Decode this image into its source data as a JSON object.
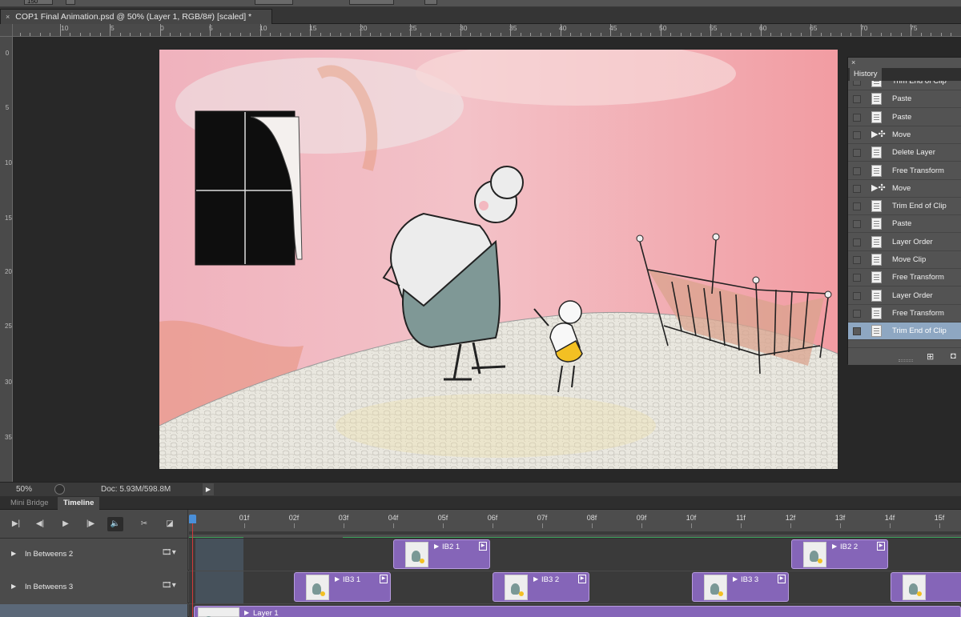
{
  "options_bar": {
    "size_value": "150"
  },
  "document": {
    "title": "COP1 Final Animation.psd @ 50% (Layer 1, RGB/8#) [scaled] *",
    "close_glyph": "×"
  },
  "rulers": {
    "top_labels": [
      "10",
      "5",
      "0",
      "5",
      "10",
      "15",
      "20",
      "25",
      "30",
      "35",
      "40",
      "45",
      "50",
      "55",
      "60",
      "65",
      "70",
      "75"
    ],
    "left_labels": [
      "0",
      "5",
      "10",
      "15",
      "20",
      "25",
      "30",
      "35"
    ]
  },
  "status": {
    "zoom": "50%",
    "doc": "Doc: 5.93M/598.8M"
  },
  "panels": {
    "tabs": [
      {
        "label": "Mini Bridge"
      },
      {
        "label": "Timeline"
      }
    ]
  },
  "timeline": {
    "controls": [
      {
        "icon": "go-to-first-frame-icon",
        "glyph": "▶|"
      },
      {
        "icon": "previous-frame-icon",
        "glyph": "◀|"
      },
      {
        "icon": "play-icon",
        "glyph": "▶"
      },
      {
        "icon": "next-frame-icon",
        "glyph": "|▶"
      },
      {
        "icon": "audio-icon",
        "glyph": "🔈"
      },
      {
        "icon": "split-at-playhead-icon",
        "glyph": "✂"
      },
      {
        "icon": "transition-icon",
        "glyph": "◪"
      }
    ],
    "frames": [
      "01f",
      "02f",
      "03f",
      "04f",
      "05f",
      "06f",
      "07f",
      "08f",
      "09f",
      "10f",
      "11f",
      "12f",
      "13f",
      "14f",
      "15f"
    ],
    "tracks": [
      {
        "name": "In Betweens 2",
        "clips": [
          {
            "label": "IB2 1"
          },
          {
            "label": "IB2 2"
          }
        ]
      },
      {
        "name": "In Betweens 3",
        "clips": [
          {
            "label": "IB3 1"
          },
          {
            "label": "IB3 2"
          },
          {
            "label": "IB3 3"
          },
          {
            "label": ""
          }
        ]
      },
      {
        "name": "",
        "clips": [
          {
            "label": "Layer 1"
          }
        ]
      }
    ]
  },
  "history": {
    "title": "History",
    "close_glyph": "×",
    "items": [
      {
        "label": "Trim End of Clip",
        "icon": "doc",
        "selected": false
      },
      {
        "label": "Paste",
        "icon": "doc",
        "selected": false
      },
      {
        "label": "Paste",
        "icon": "doc",
        "selected": false
      },
      {
        "label": "Move",
        "icon": "move",
        "selected": false
      },
      {
        "label": "Delete Layer",
        "icon": "doc",
        "selected": false
      },
      {
        "label": "Free Transform",
        "icon": "doc",
        "selected": false
      },
      {
        "label": "Move",
        "icon": "move",
        "selected": false
      },
      {
        "label": "Trim End of Clip",
        "icon": "doc",
        "selected": false
      },
      {
        "label": "Paste",
        "icon": "doc",
        "selected": false
      },
      {
        "label": "Layer Order",
        "icon": "doc",
        "selected": false
      },
      {
        "label": "Move Clip",
        "icon": "doc",
        "selected": false
      },
      {
        "label": "Free Transform",
        "icon": "doc",
        "selected": false
      },
      {
        "label": "Layer Order",
        "icon": "doc",
        "selected": false
      },
      {
        "label": "Free Transform",
        "icon": "doc",
        "selected": false
      },
      {
        "label": "Trim End of Clip",
        "icon": "doc",
        "selected": true
      }
    ]
  },
  "colors": {
    "clip": "#8565b8",
    "selected_history": "#8ea7c2",
    "playhead": "#d23a3a"
  }
}
